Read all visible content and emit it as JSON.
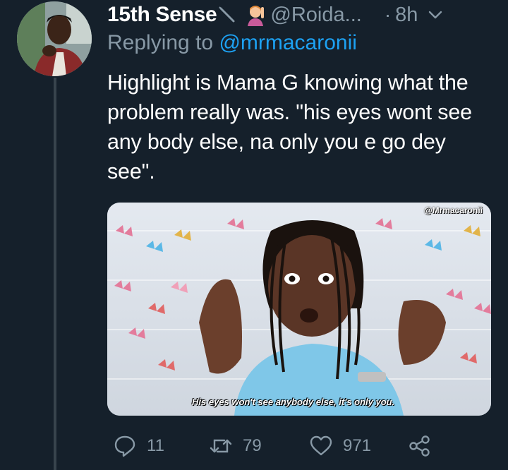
{
  "author": {
    "display_name": "15th Sense",
    "handle": "@Roida...",
    "separator": "·",
    "time": "8h"
  },
  "reply": {
    "prefix": "Replying to",
    "mention": "@mrmacaronii"
  },
  "tweet": {
    "text": "Highlight is Mama G knowing what the problem really was. \"his eyes wont see any body else, na only you e go dey see\"."
  },
  "media": {
    "watermark": "@Mrmacaronii",
    "subtitle": "His eyes won't see anybody else, it's only you."
  },
  "actions": {
    "replies": "11",
    "retweets": "79",
    "likes": "971"
  },
  "icons": {
    "reply": "reply-icon",
    "retweet": "retweet-icon",
    "like": "heart-icon",
    "share": "share-icon",
    "menu": "chevron-down-icon"
  },
  "colors": {
    "background": "#15202b",
    "secondary_text": "#8899a6",
    "link": "#1da1f2",
    "thread_line": "#38444d"
  }
}
